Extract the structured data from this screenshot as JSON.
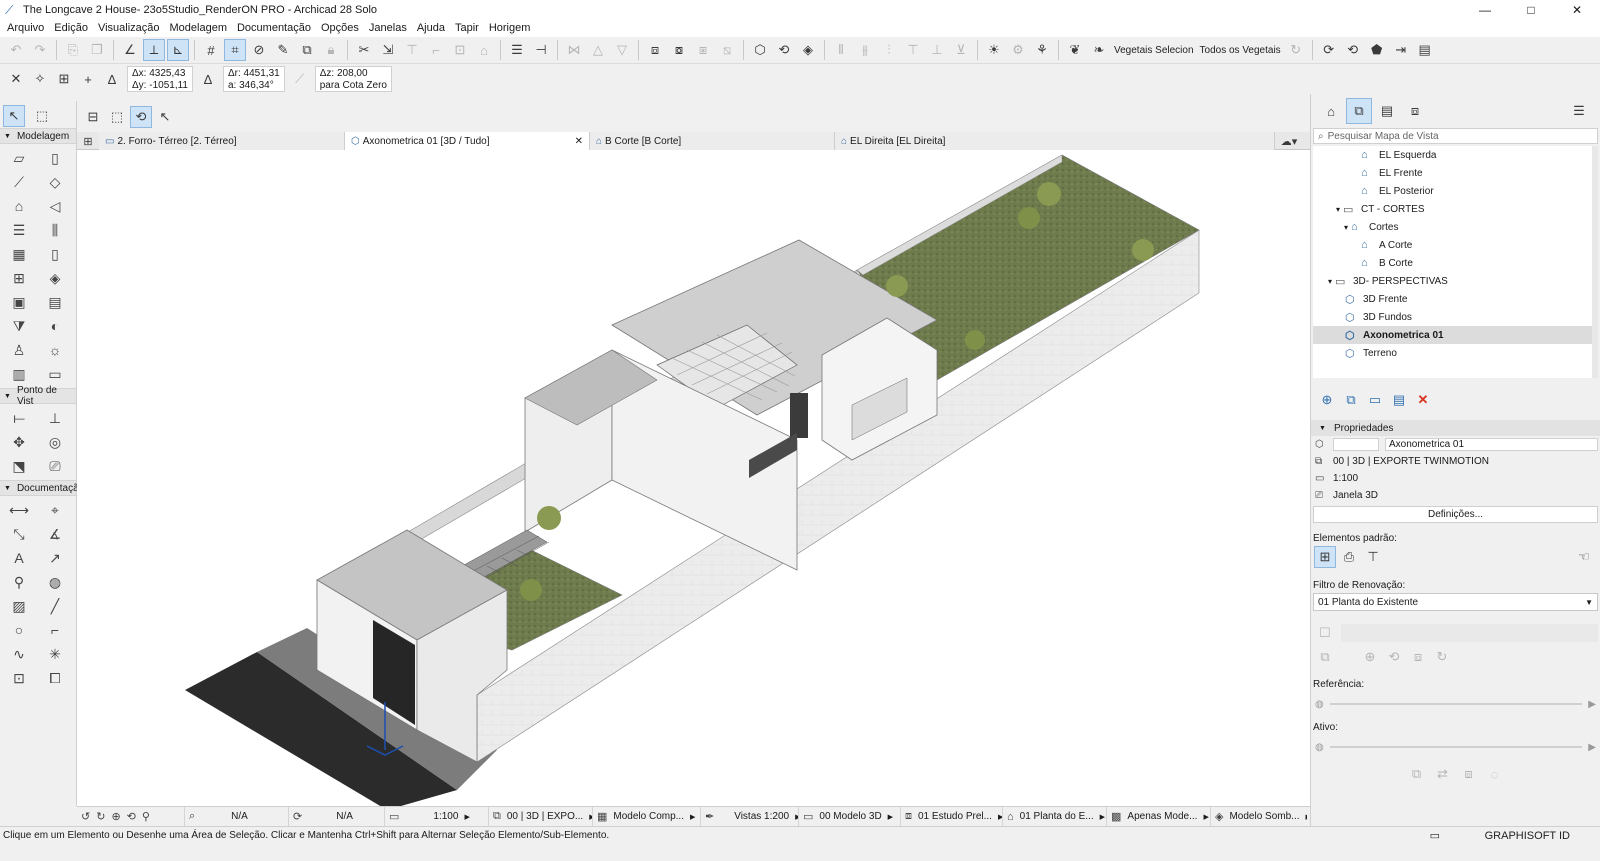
{
  "window": {
    "title": "The Longcave 2 House- 23o5Studio_RenderON PRO - Archicad 28 Solo",
    "controls": [
      "—",
      "□",
      "✕"
    ]
  },
  "menu": [
    "Arquivo",
    "Edição",
    "Visualização",
    "Modelagem",
    "Documentação",
    "Opções",
    "Janelas",
    "Ajuda",
    "Tapir",
    "Horigem"
  ],
  "toolbar": {
    "vegetation_selected": "Vegetais Selecion",
    "all_vegetation": "Todos os Vegetais"
  },
  "coords": {
    "dx": "Δx: 4325,43",
    "dy": "Δy: -1051,11",
    "dr": "Δr: 4451,31",
    "a": "a:  346,34°",
    "dz": "Δz: 208,00",
    "zref": "para Cota Zero"
  },
  "toolbox": {
    "sections": [
      "Modelagem",
      "Ponto de Vist",
      "Documentaçã"
    ]
  },
  "tabs": [
    {
      "label": "2. Forro- Térreo [2. Térreo]",
      "icon": "floorplan-icon"
    },
    {
      "label": "Axonometrica 01 [3D / Tudo]",
      "icon": "3d-view-icon",
      "active": true
    },
    {
      "label": "B Corte [B Corte]",
      "icon": "section-icon"
    },
    {
      "label": "EL Direita [EL Direita]",
      "icon": "elevation-icon"
    }
  ],
  "navigator": {
    "search_placeholder": "Pesquisar Mapa de Vista",
    "items": [
      {
        "label": "EL Esquerda",
        "level": 3
      },
      {
        "label": "EL Frente",
        "level": 3
      },
      {
        "label": "EL Posterior",
        "level": 3
      },
      {
        "label": "CT - CORTES",
        "level": 1,
        "folder": true
      },
      {
        "label": "Cortes",
        "level": 2
      },
      {
        "label": "A Corte",
        "level": 3
      },
      {
        "label": "B Corte",
        "level": 3
      },
      {
        "label": "3D- PERSPECTIVAS",
        "level": 0,
        "folder": true
      },
      {
        "label": "3D Frente",
        "level": 1
      },
      {
        "label": "3D Fundos",
        "level": 1
      },
      {
        "label": "Axonometrica 01",
        "level": 1,
        "selected": true
      },
      {
        "label": "Terreno",
        "level": 1
      }
    ]
  },
  "properties": {
    "header": "Propriedades",
    "name": "Axonometrica 01",
    "layer_combo": "00 | 3D | EXPORTE TWINMOTION",
    "scale": "1:100",
    "window_type": "Janela 3D",
    "settings_button": "Definições...",
    "default_elements_label": "Elementos padrão:",
    "renovation_filter_label": "Filtro de Renovação:",
    "renovation_filter_value": "01 Planta do Existente",
    "reference_label": "Referência:",
    "active_label": "Ativo:"
  },
  "view_status": [
    {
      "label": "N/A",
      "w": 0
    },
    {
      "label": "N/A"
    },
    {
      "label": "1:100"
    },
    {
      "label": "00 | 3D | EXPO..."
    },
    {
      "label": "Modelo Comp..."
    },
    {
      "label": "Vistas 1:200"
    },
    {
      "label": "00 Modelo 3D"
    },
    {
      "label": "01 Estudo Prel..."
    },
    {
      "label": "01 Planta do E..."
    },
    {
      "label": "Apenas Mode..."
    },
    {
      "label": "Modelo Somb..."
    }
  ],
  "status_message": "Clique em um Elemento ou Desenhe uma Área de Seleção. Clicar e Mantenha Ctrl+Shift para Alternar Seleção Elemento/Sub-Elemento.",
  "brand": "GRAPHISOFT ID",
  "colors": {
    "accent": "#2f6fb0",
    "grass": "#6b7a4a",
    "wall": "#e9e9e9",
    "road": "#2b2b2b"
  }
}
